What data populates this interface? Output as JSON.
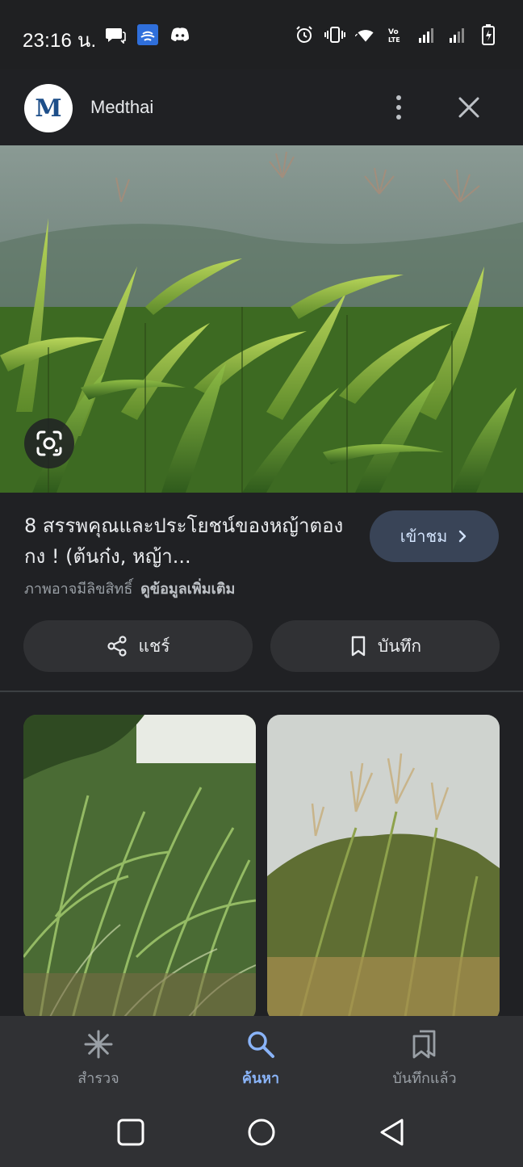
{
  "status_bar": {
    "time": "23:16 น.",
    "left_icons": [
      "message-icon",
      "cast-icon",
      "discord-icon"
    ],
    "right_icons": [
      "alarm-icon",
      "vibrate-icon",
      "wifi-icon",
      "volte-icon",
      "signal-icon",
      "signal-icon",
      "battery-charging-icon"
    ]
  },
  "header": {
    "logo_letter": "M",
    "site_name": "Medthai",
    "logo_color": "#1d4e89"
  },
  "result": {
    "title": "8 สรรพคุณและประโยชน์ของหญ้าตองกง ! (ต้นก๋ง, หญ้า...",
    "copyright_text": "ภาพอาจมีลิขสิทธิ์",
    "more_info_link": "ดูข้อมูลเพิ่มเติม",
    "visit_label": "เข้าชม",
    "share_label": "แชร์",
    "save_label": "บันทึก"
  },
  "bottom_nav": {
    "items": [
      {
        "label": "สำรวจ",
        "icon": "asterisk-icon",
        "active": false
      },
      {
        "label": "ค้นหา",
        "icon": "search-icon",
        "active": true
      },
      {
        "label": "บันทึกแล้ว",
        "icon": "saved-collections-icon",
        "active": false
      }
    ]
  },
  "colors": {
    "background": "#202124",
    "accent": "#8ab4f8",
    "visit_button": "#394457"
  }
}
